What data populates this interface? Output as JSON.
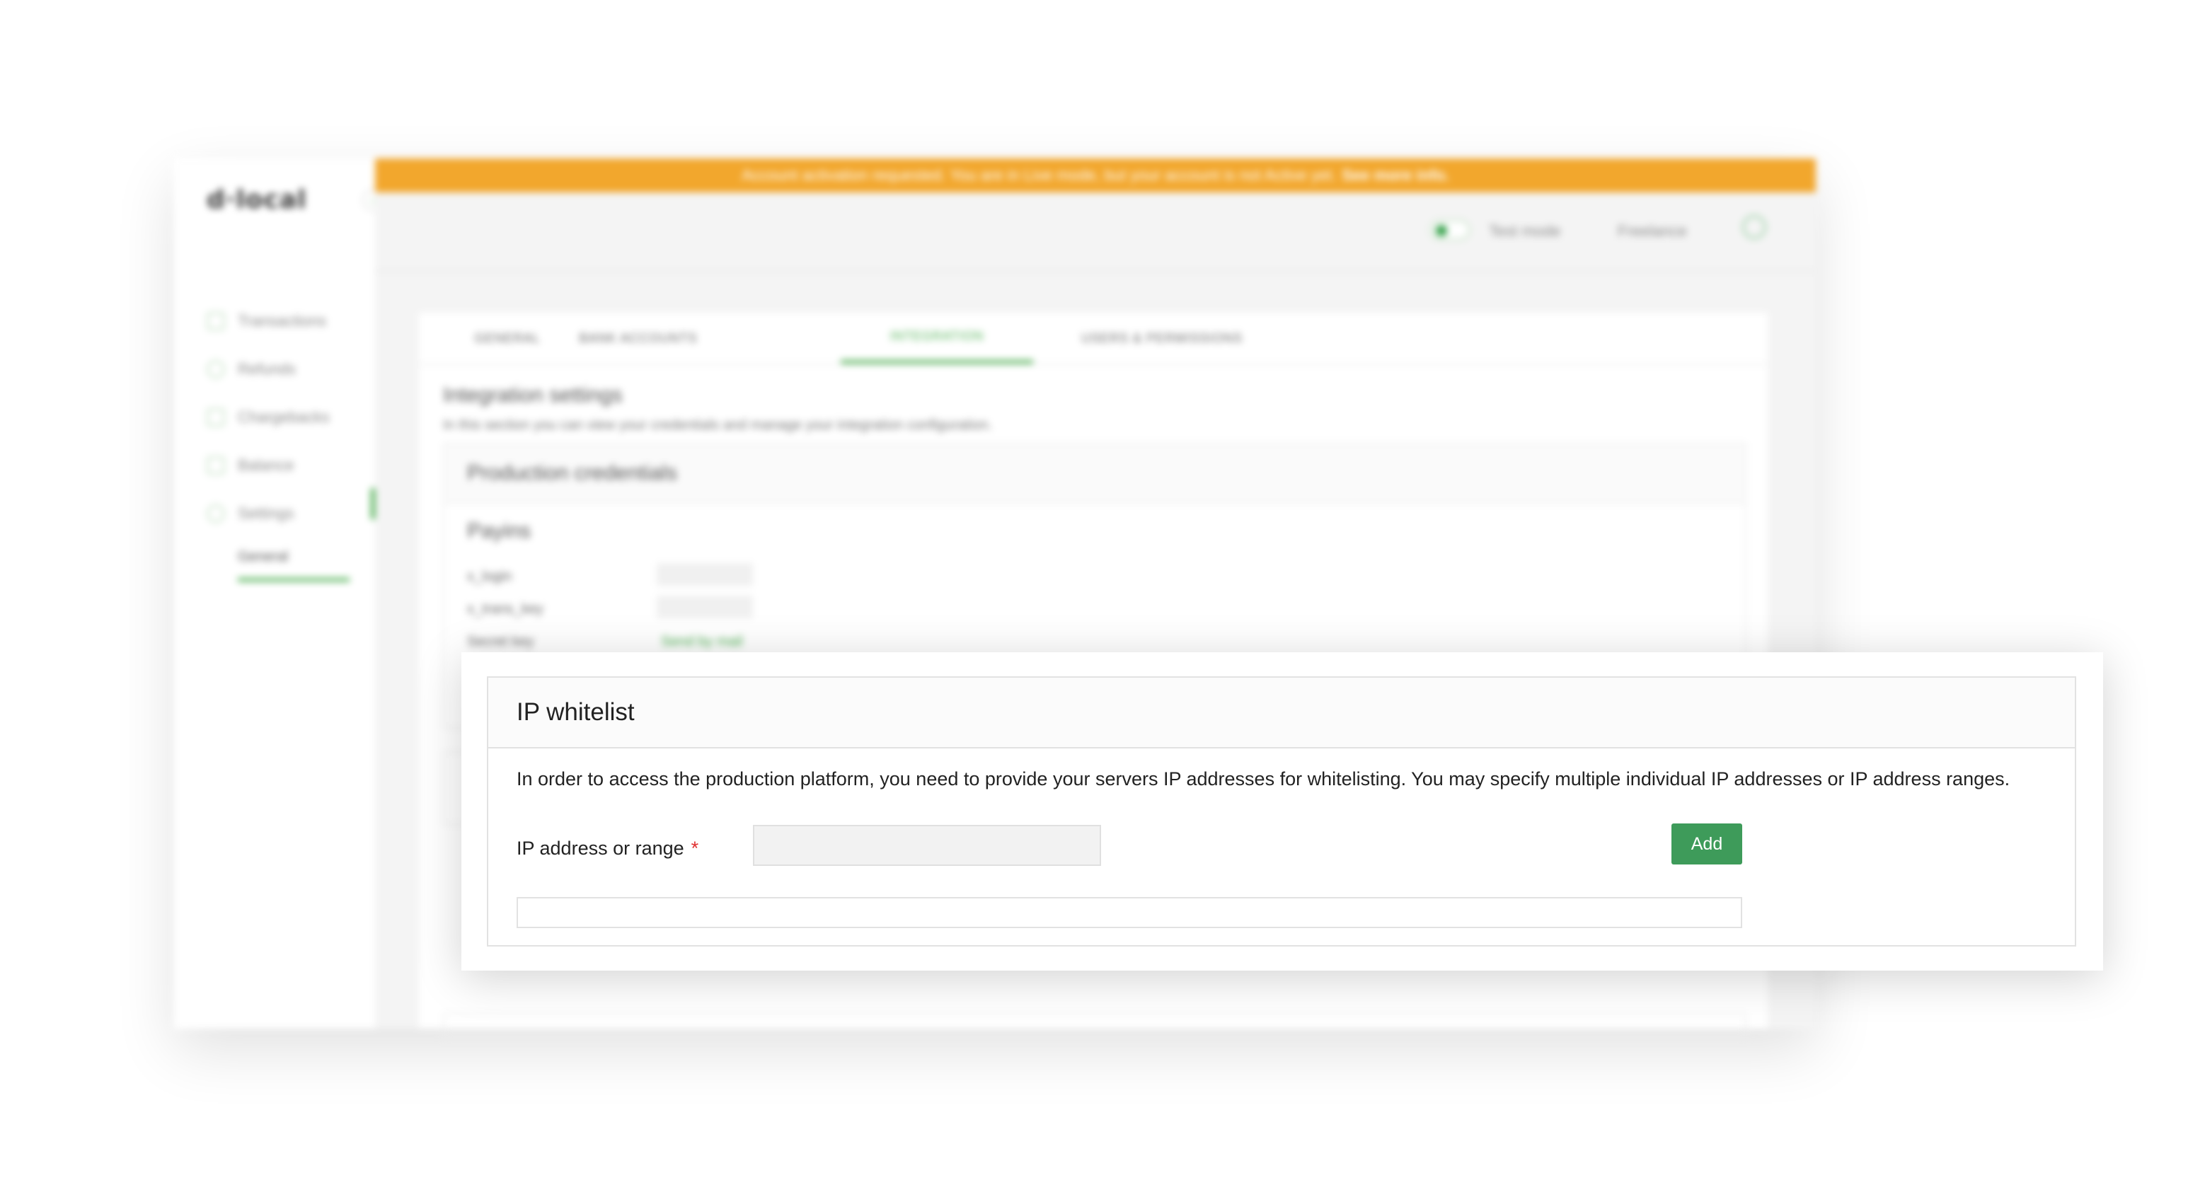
{
  "app": {
    "logo": "d·local",
    "banner": {
      "text": "Account activation requested. You are in Live mode, but your account is not Active yet.",
      "link": "See more info."
    },
    "topbar": {
      "test_mode_label": "Test mode",
      "account_name": "Freelance"
    },
    "sidebar": {
      "items": [
        {
          "label": "Transactions",
          "icon": "transactions-icon"
        },
        {
          "label": "Refunds",
          "icon": "refunds-icon"
        },
        {
          "label": "Chargebacks",
          "icon": "chargebacks-icon"
        },
        {
          "label": "Balance",
          "icon": "balance-icon"
        },
        {
          "label": "Settings",
          "icon": "settings-icon"
        }
      ],
      "sub_item": "General"
    },
    "tabs": [
      "GENERAL",
      "BANK ACCOUNTS",
      "INTEGRATION",
      "USERS & PERMISSIONS"
    ],
    "active_tab": "INTEGRATION",
    "integration": {
      "title": "Integration settings",
      "description": "In this section you can view your credentials and manage your integration configuration.",
      "production_credentials": "Production credentials",
      "payins": "Payins",
      "fields": [
        "x_login",
        "x_trans_key",
        "Secret key"
      ],
      "secret_key_link": "Send by mail"
    }
  },
  "modal": {
    "title": "IP whitelist",
    "description": "In order to access the production platform, you need to provide your servers IP addresses for whitelisting. You may specify multiple individual IP addresses or IP address ranges.",
    "field_label": "IP address or range",
    "required_mark": "*",
    "input_value": "",
    "add_label": "Add"
  },
  "colors": {
    "accent": "#4caf50",
    "banner": "#f2a72d",
    "add_button": "#3e9b5a",
    "required": "#e03131"
  }
}
